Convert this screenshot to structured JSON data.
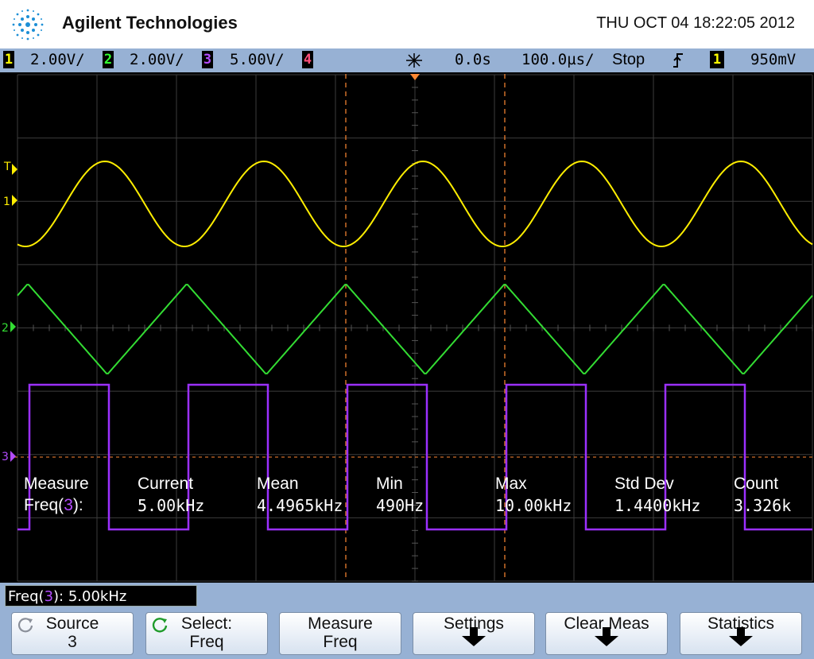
{
  "header": {
    "brand": "Agilent Technologies",
    "datetime": "THU OCT 04 18:22:05 2012"
  },
  "status": {
    "channels": [
      {
        "num": "1",
        "scale": "2.00V/",
        "color": "#ffff00"
      },
      {
        "num": "2",
        "scale": "2.00V/",
        "color": "#33ff33"
      },
      {
        "num": "3",
        "scale": "5.00V/",
        "color": "#b44cff"
      },
      {
        "num": "4",
        "scale": "",
        "color": "#ff4f7a"
      }
    ],
    "delay": "0.0s",
    "timebase": "100.0µs/",
    "run_state": "Stop",
    "trigger_source": "1",
    "trigger_level": "950mV"
  },
  "screen": {
    "markers": {
      "trigger": "T",
      "ch1": "1",
      "ch2": "2",
      "ch3": "3"
    }
  },
  "measurement": {
    "headers": [
      "Measure",
      "Current",
      "Mean",
      "Min",
      "Max",
      "Std Dev",
      "Count"
    ],
    "row_label": "Freq(",
    "row_channel": "3",
    "row_label_end": "):",
    "values": [
      "5.00kHz",
      "4.4965kHz",
      "490Hz",
      "10.00kHz",
      "1.4400kHz",
      "3.326k"
    ]
  },
  "info_box": {
    "prefix": "Freq(",
    "channel": "3",
    "suffix": "): 5.00kHz"
  },
  "softkeys": [
    {
      "line1": "Source",
      "line2": "3"
    },
    {
      "line1": "Select:",
      "line2": "Freq"
    },
    {
      "line1": "Measure",
      "line2": "Freq"
    },
    {
      "line1": "Settings",
      "line2": ""
    },
    {
      "line1": "Clear Meas",
      "line2": ""
    },
    {
      "line1": "Statistics",
      "line2": ""
    }
  ]
}
